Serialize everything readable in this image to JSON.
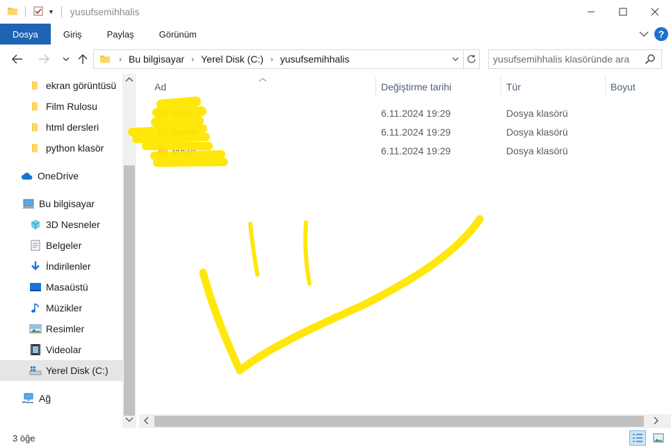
{
  "window": {
    "title": "yusufsemihhalis",
    "accent_color": "#1e64b4"
  },
  "ribbon": {
    "tabs": [
      "Dosya",
      "Giriş",
      "Paylaş",
      "Görünüm"
    ]
  },
  "address": {
    "crumbs": [
      "Bu bilgisayar",
      "Yerel Disk (C:)",
      "yusufsemihhalis"
    ]
  },
  "search": {
    "placeholder": "yusufsemihhalis klasöründe ara"
  },
  "sidebar": {
    "items": [
      {
        "label": "ekran görüntüsü",
        "icon": "folder-icon"
      },
      {
        "label": "Film Rulosu",
        "icon": "folder-icon"
      },
      {
        "label": "html dersleri",
        "icon": "folder-icon"
      },
      {
        "label": "python klasör",
        "icon": "folder-icon"
      },
      {
        "label": "OneDrive",
        "icon": "cloud-icon"
      },
      {
        "label": "Bu bilgisayar",
        "icon": "computer-icon"
      },
      {
        "label": "3D Nesneler",
        "icon": "cube-icon"
      },
      {
        "label": "Belgeler",
        "icon": "document-icon"
      },
      {
        "label": "İndirilenler",
        "icon": "download-icon"
      },
      {
        "label": "Masaüstü",
        "icon": "desktop-icon"
      },
      {
        "label": "Müzikler",
        "icon": "music-icon"
      },
      {
        "label": "Resimler",
        "icon": "picture-icon"
      },
      {
        "label": "Videolar",
        "icon": "video-icon"
      },
      {
        "label": "Yerel Disk (C:)",
        "icon": "disk-icon"
      },
      {
        "label": "Ağ",
        "icon": "network-icon"
      }
    ]
  },
  "table": {
    "columns": [
      "Ad",
      "Değiştirme tarihi",
      "Tür",
      "Boyut"
    ],
    "rows": [
      {
        "name": "halis",
        "date": "6.11.2024 19:29",
        "type": "Dosya klasörü",
        "size": ""
      },
      {
        "name": "semih",
        "date": "6.11.2024 19:29",
        "type": "Dosya klasörü",
        "size": ""
      },
      {
        "name": "yusuf",
        "date": "6.11.2024 19:29",
        "type": "Dosya klasörü",
        "size": ""
      }
    ]
  },
  "status": {
    "count": "3 öğe"
  },
  "highlight_color": "#ffe600"
}
